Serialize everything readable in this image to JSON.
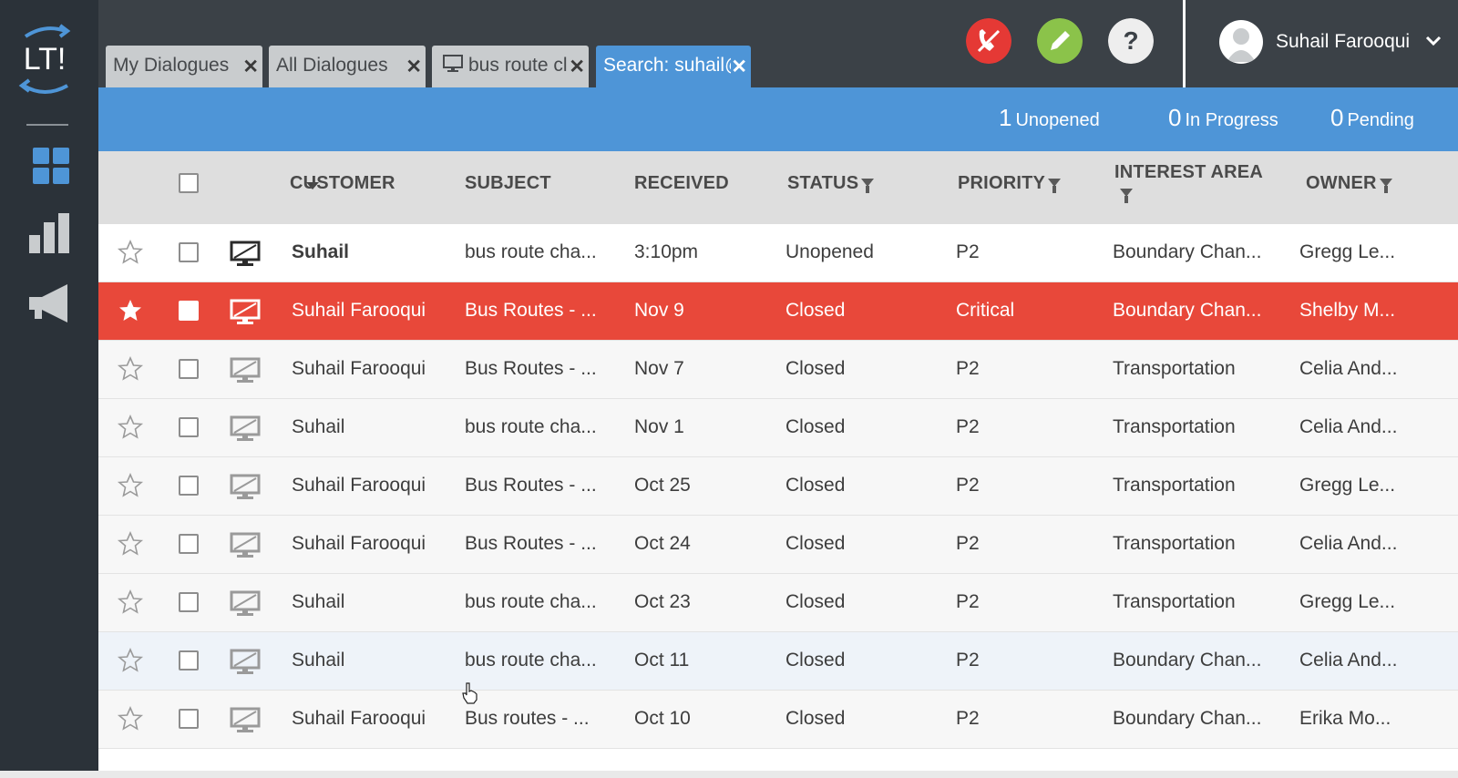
{
  "app": {
    "logo_text": "LT!"
  },
  "rail": [
    {
      "icon": "dashboard-grid-icon"
    },
    {
      "icon": "bar-chart-icon"
    },
    {
      "icon": "megaphone-icon"
    }
  ],
  "tabs": [
    {
      "label": "My Dialogues",
      "active": false
    },
    {
      "label": "All Dialogues",
      "active": false
    },
    {
      "label": "bus route cl",
      "active": false,
      "icon": "monitor-icon"
    },
    {
      "label": "Search: suhail@",
      "active": true
    }
  ],
  "header_actions": [
    {
      "icon": "end-call-icon",
      "color": "#e53935"
    },
    {
      "icon": "pencil-icon",
      "color": "#8bc34a"
    },
    {
      "icon": "help-icon",
      "color": "#eeeeee"
    }
  ],
  "user": {
    "name": "Suhail Farooqui"
  },
  "stats": [
    {
      "count": "1",
      "label": "Unopened"
    },
    {
      "count": "0",
      "label": "In Progress"
    },
    {
      "count": "0",
      "label": "Pending"
    }
  ],
  "columns": {
    "customer": "CUSTOMER",
    "subject": "SUBJECT",
    "received": "RECEIVED",
    "status": "STATUS",
    "priority": "PRIORITY",
    "interest_area": "INTEREST AREA",
    "owner": "OWNER"
  },
  "rows": [
    {
      "starred": false,
      "unread": true,
      "style": "white",
      "customer": "Suhail",
      "subject": "bus route cha...",
      "received": "3:10pm",
      "status": "Unopened",
      "priority": "P2",
      "interest_area": "Boundary Chan...",
      "owner": "Gregg Le..."
    },
    {
      "starred": true,
      "unread": false,
      "style": "critical",
      "customer": "Suhail Farooqui",
      "subject": "Bus Routes - ...",
      "received": "Nov 9",
      "status": "Closed",
      "priority": "Critical",
      "interest_area": "Boundary Chan...",
      "owner": "Shelby M..."
    },
    {
      "starred": false,
      "unread": false,
      "style": "grey",
      "customer": "Suhail Farooqui",
      "subject": "Bus Routes - ...",
      "received": "Nov 7",
      "status": "Closed",
      "priority": "P2",
      "interest_area": "Transportation",
      "owner": "Celia And..."
    },
    {
      "starred": false,
      "unread": false,
      "style": "grey",
      "customer": "Suhail",
      "subject": "bus route cha...",
      "received": "Nov 1",
      "status": "Closed",
      "priority": "P2",
      "interest_area": "Transportation",
      "owner": "Celia And..."
    },
    {
      "starred": false,
      "unread": false,
      "style": "grey",
      "customer": "Suhail Farooqui",
      "subject": "Bus Routes - ...",
      "received": "Oct 25",
      "status": "Closed",
      "priority": "P2",
      "interest_area": "Transportation",
      "owner": "Gregg Le..."
    },
    {
      "starred": false,
      "unread": false,
      "style": "grey",
      "customer": "Suhail Farooqui",
      "subject": "Bus Routes - ...",
      "received": "Oct 24",
      "status": "Closed",
      "priority": "P2",
      "interest_area": "Transportation",
      "owner": "Celia And..."
    },
    {
      "starred": false,
      "unread": false,
      "style": "grey",
      "customer": "Suhail",
      "subject": "bus route cha...",
      "received": "Oct 23",
      "status": "Closed",
      "priority": "P2",
      "interest_area": "Transportation",
      "owner": "Gregg Le..."
    },
    {
      "starred": false,
      "unread": false,
      "style": "hover",
      "customer": "Suhail",
      "subject": "bus route cha...",
      "received": "Oct 11",
      "status": "Closed",
      "priority": "P2",
      "interest_area": "Boundary Chan...",
      "owner": "Celia And..."
    },
    {
      "starred": false,
      "unread": false,
      "style": "grey",
      "customer": "Suhail Farooqui",
      "subject": "Bus routes - ...",
      "received": "Oct 10",
      "status": "Closed",
      "priority": "P2",
      "interest_area": "Boundary Chan...",
      "owner": "Erika Mo..."
    }
  ]
}
